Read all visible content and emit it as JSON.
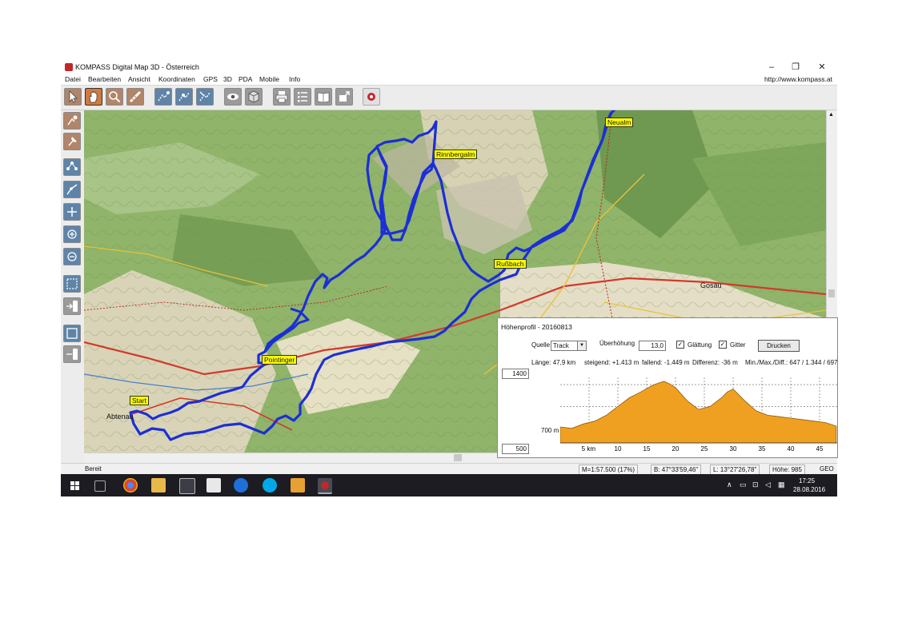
{
  "window": {
    "title": "KOMPASS Digital Map 3D - Österreich",
    "controls": {
      "minimize": "–",
      "maximize": "❐",
      "close": "✕"
    }
  },
  "menubar": {
    "items": [
      "Datei",
      "Bearbeiten",
      "Ansicht",
      "Koordinaten",
      "GPS",
      "3D",
      "PDA",
      "Mobile",
      "Info"
    ],
    "url": "http://www.kompass.at"
  },
  "toolbar": {
    "buttons": [
      "pointer-icon",
      "hand-icon",
      "zoom-icon",
      "measure-icon",
      "route-icon",
      "route-edit-icon",
      "route-delete-icon",
      "eye-icon",
      "cube-3d-icon",
      "print-icon",
      "list-icon",
      "book-icon",
      "export-icon",
      "compass-icon"
    ]
  },
  "map": {
    "labels": {
      "start": "Start",
      "pointinger": "Pointinger",
      "russbach": "Rußbach",
      "rinnbergalm": "Rinnbergalm",
      "neualm": "Neualm"
    },
    "place_names": {
      "abtenau": "Abtenau",
      "gosau": "Gosau"
    },
    "colors": {
      "track": "#1c2fd4",
      "label_bg": "#ffff00"
    }
  },
  "profile": {
    "title": "Höhenprofil - 20160813",
    "quelle_label": "Quelle",
    "quelle_value": "Track",
    "ueberhoehung_label": "Überhöhung",
    "ueberhoehung_value": "13,0",
    "glaettung_label": "Glättung",
    "glaettung_checked": true,
    "gitter_label": "Gitter",
    "gitter_checked": true,
    "drucken": "Drucken",
    "stats": {
      "laenge": "Länge: 47,9 km",
      "steigend": "steigend: +1.413 m",
      "fallend": "fallend: -1.449 m",
      "differenz": "Differenz: -36 m",
      "minmax": "Min./Max./Diff.: 647 / 1.344 / 697"
    },
    "y_top": "1400",
    "y_bottom": "500",
    "y_mid_label": "700 m",
    "x_ticks": [
      "5 km",
      "10",
      "15",
      "20",
      "25",
      "30",
      "35",
      "40",
      "45"
    ],
    "fill_color": "#f0a020"
  },
  "chart_data": {
    "type": "area",
    "title": "Höhenprofil - 20160813",
    "xlabel": "",
    "ylabel": "",
    "ylim": [
      500,
      1400
    ],
    "x": [
      0,
      2,
      4,
      6,
      8,
      10,
      12,
      14,
      16,
      17,
      18,
      19,
      20,
      22,
      24,
      26,
      28,
      29,
      30,
      32,
      34,
      36,
      38,
      40,
      42,
      44,
      46,
      47.9
    ],
    "series": [
      {
        "values": [
          720,
          700,
          760,
          800,
          880,
          1000,
          1120,
          1200,
          1290,
          1320,
          1344,
          1310,
          1260,
          1080,
          960,
          1000,
          1120,
          1200,
          1240,
          1080,
          940,
          880,
          860,
          840,
          820,
          800,
          780,
          730
        ]
      }
    ],
    "grid": true
  },
  "statusbar": {
    "status": "Bereit",
    "scale": "M=1:57.500 (17%)",
    "lat": "B: 47°33'59,46\"",
    "lon": "L: 13°27'26,78\"",
    "height": "Höhe: 985",
    "mode": "GEO"
  },
  "taskbar": {
    "time": "17:25",
    "date": "28.08.2016"
  }
}
